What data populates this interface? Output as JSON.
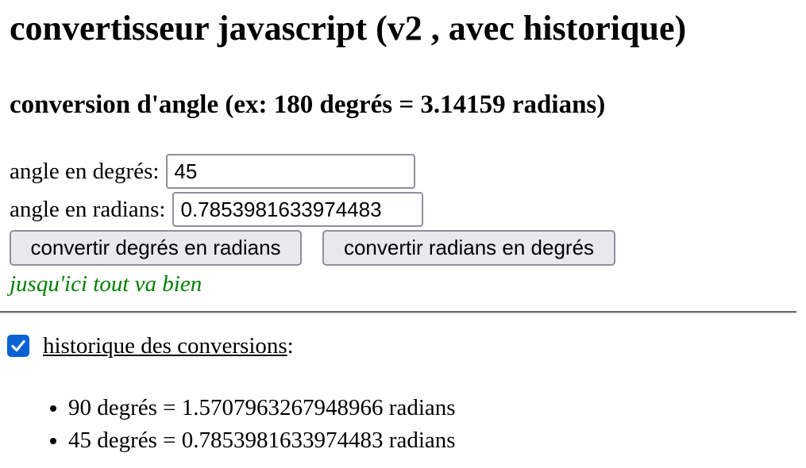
{
  "page": {
    "title": "convertisseur javascript (v2 , avec historique)",
    "subtitle": "conversion d'angle (ex: 180 degrés = 3.14159 radians)"
  },
  "form": {
    "degrees_label": "angle en degrés:",
    "degrees_value": "45",
    "radians_label": "angle en radians:",
    "radians_value": "0.7853981633974483",
    "btn_deg_to_rad": "convertir degrés en radians",
    "btn_rad_to_deg": "convertir radians en degrés",
    "status": "jusqu'ici tout va bien",
    "status_color": "#008000"
  },
  "history": {
    "checked": true,
    "label": "historique des conversions",
    "label_suffix": ":",
    "items": [
      "90 degrés = 1.5707963267948966 radians",
      "45 degrés = 0.7853981633974483 radians"
    ]
  },
  "colors": {
    "checkbox_accent": "#0a63d4",
    "button_bg": "#e9e9ed",
    "input_border": "#8f8f9d"
  },
  "icons": {
    "checkbox": "checkmark-icon"
  }
}
